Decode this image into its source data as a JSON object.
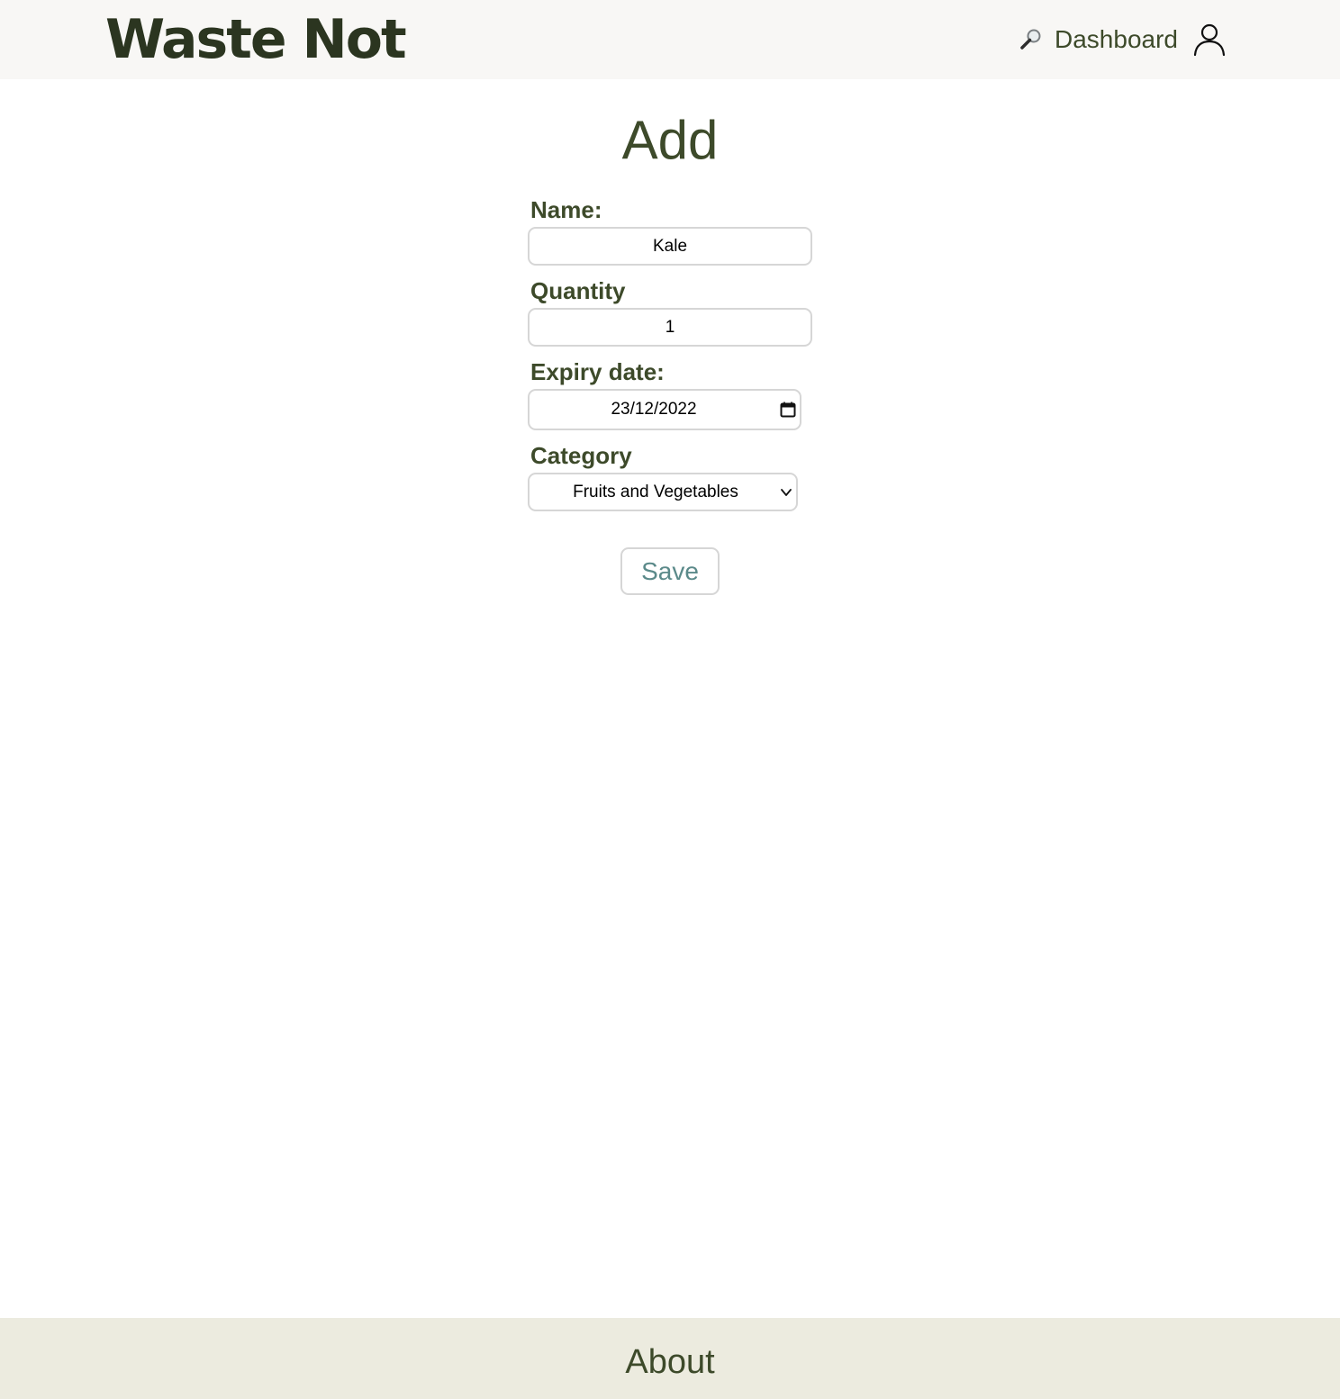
{
  "header": {
    "logo": "Waste Not",
    "nav": {
      "search_icon": "magnifying-glass",
      "dashboard_label": "Dashboard",
      "user_icon": "user-profile"
    }
  },
  "main": {
    "title": "Add",
    "form": {
      "name_label": "Name:",
      "name_value": "Kale",
      "quantity_label": "Quantity",
      "quantity_value": "1",
      "expiry_label": "Expiry date:",
      "expiry_value": "23/12/2022",
      "category_label": "Category",
      "category_value": "Fruits and Vegetables",
      "save_label": "Save"
    }
  },
  "footer": {
    "about_label": "About"
  },
  "colors": {
    "text_primary": "#3d4a2a",
    "logo": "#2b3520",
    "header_bg": "#f8f7f5",
    "footer_bg": "#ecebdf",
    "save_text": "#5b8a8a",
    "input_border": "#d6d6d6"
  }
}
